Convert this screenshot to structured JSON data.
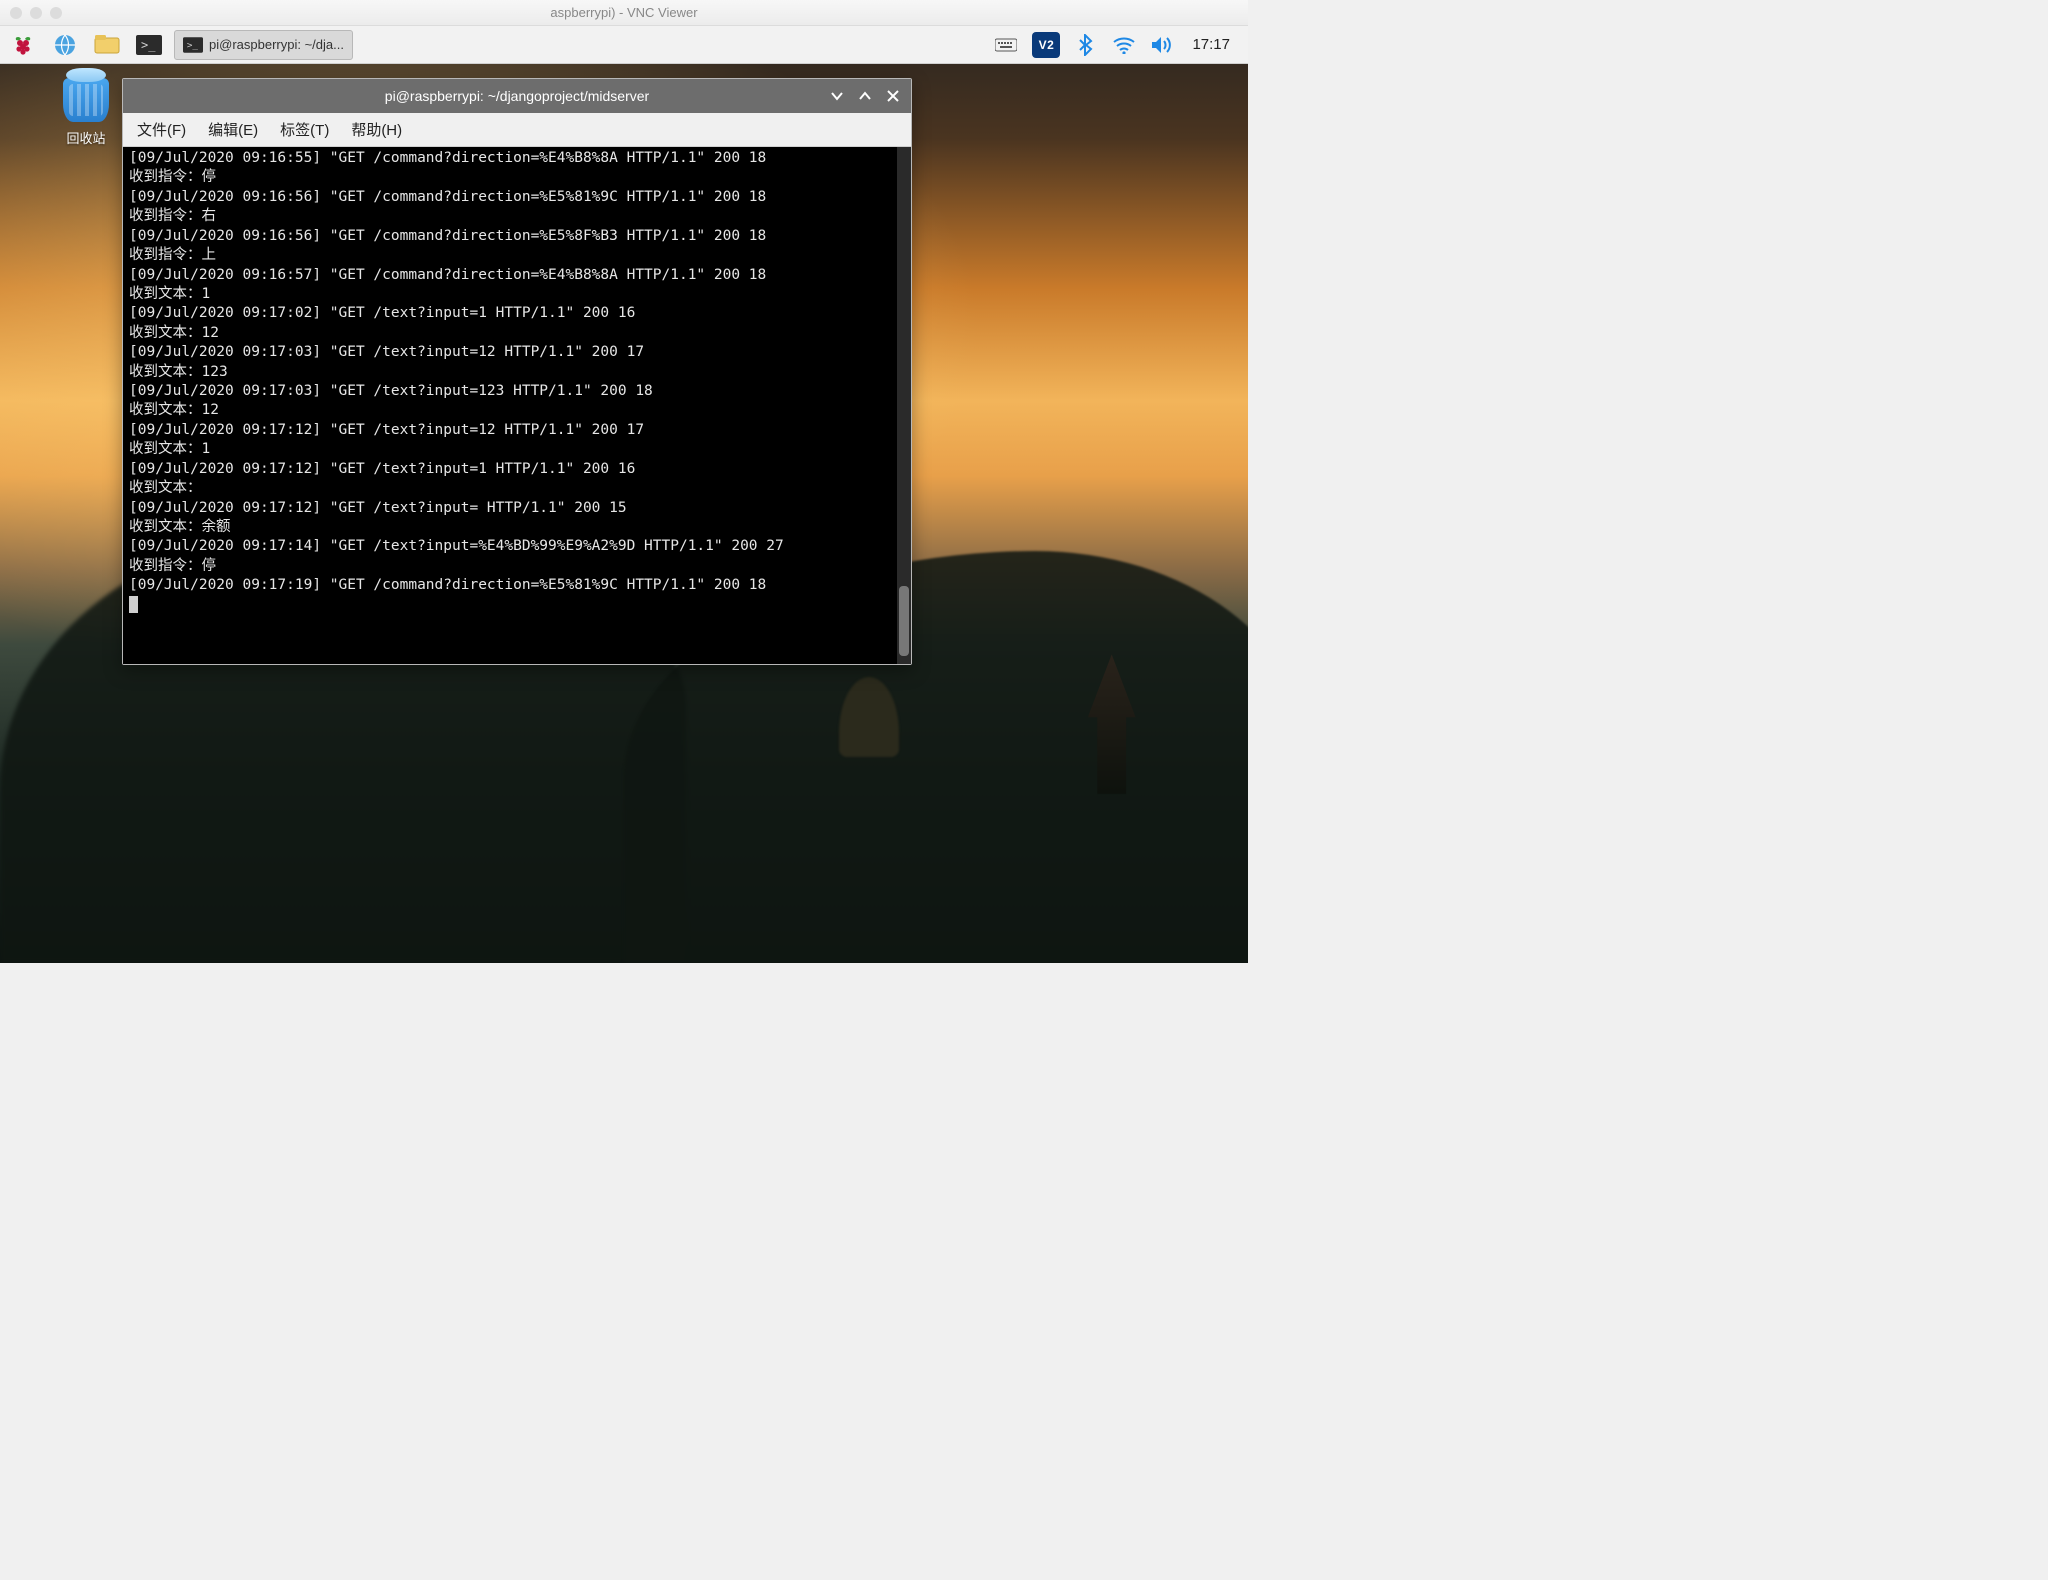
{
  "host": {
    "title": "aspberrypi) - VNC Viewer"
  },
  "taskbar": {
    "appmenu_name": "raspberry-menu-icon",
    "browser_name": "web-browser-icon",
    "files_name": "file-manager-icon",
    "terminal_name": "terminal-icon",
    "task_label": "pi@raspberrypi: ~/dja...",
    "clock": "17:17"
  },
  "tray": {
    "kbd_name": "keyboard-icon",
    "vnc_label": "V2",
    "bt_name": "bluetooth-icon",
    "wifi_name": "wifi-icon",
    "sound_name": "sound-icon"
  },
  "desktop": {
    "recycle_label": "回收站"
  },
  "terminal": {
    "title": "pi@raspberrypi: ~/djangoproject/midserver",
    "menu": {
      "file": "文件(F)",
      "edit": "编辑(E)",
      "tabs": "标签(T)",
      "help": "帮助(H)"
    },
    "lines": [
      "[09/Jul/2020 09:16:55] \"GET /command?direction=%E4%B8%8A HTTP/1.1\" 200 18",
      "收到指令：停",
      "[09/Jul/2020 09:16:56] \"GET /command?direction=%E5%81%9C HTTP/1.1\" 200 18",
      "收到指令：右",
      "[09/Jul/2020 09:16:56] \"GET /command?direction=%E5%8F%B3 HTTP/1.1\" 200 18",
      "收到指令：上",
      "[09/Jul/2020 09:16:57] \"GET /command?direction=%E4%B8%8A HTTP/1.1\" 200 18",
      "收到文本：1",
      "[09/Jul/2020 09:17:02] \"GET /text?input=1 HTTP/1.1\" 200 16",
      "收到文本：12",
      "[09/Jul/2020 09:17:03] \"GET /text?input=12 HTTP/1.1\" 200 17",
      "收到文本：123",
      "[09/Jul/2020 09:17:03] \"GET /text?input=123 HTTP/1.1\" 200 18",
      "收到文本：12",
      "[09/Jul/2020 09:17:12] \"GET /text?input=12 HTTP/1.1\" 200 17",
      "收到文本：1",
      "[09/Jul/2020 09:17:12] \"GET /text?input=1 HTTP/1.1\" 200 16",
      "收到文本：",
      "[09/Jul/2020 09:17:12] \"GET /text?input= HTTP/1.1\" 200 15",
      "收到文本：余额",
      "[09/Jul/2020 09:17:14] \"GET /text?input=%E4%BD%99%E9%A2%9D HTTP/1.1\" 200 27",
      "收到指令：停",
      "[09/Jul/2020 09:17:19] \"GET /command?direction=%E5%81%9C HTTP/1.1\" 200 18"
    ]
  }
}
